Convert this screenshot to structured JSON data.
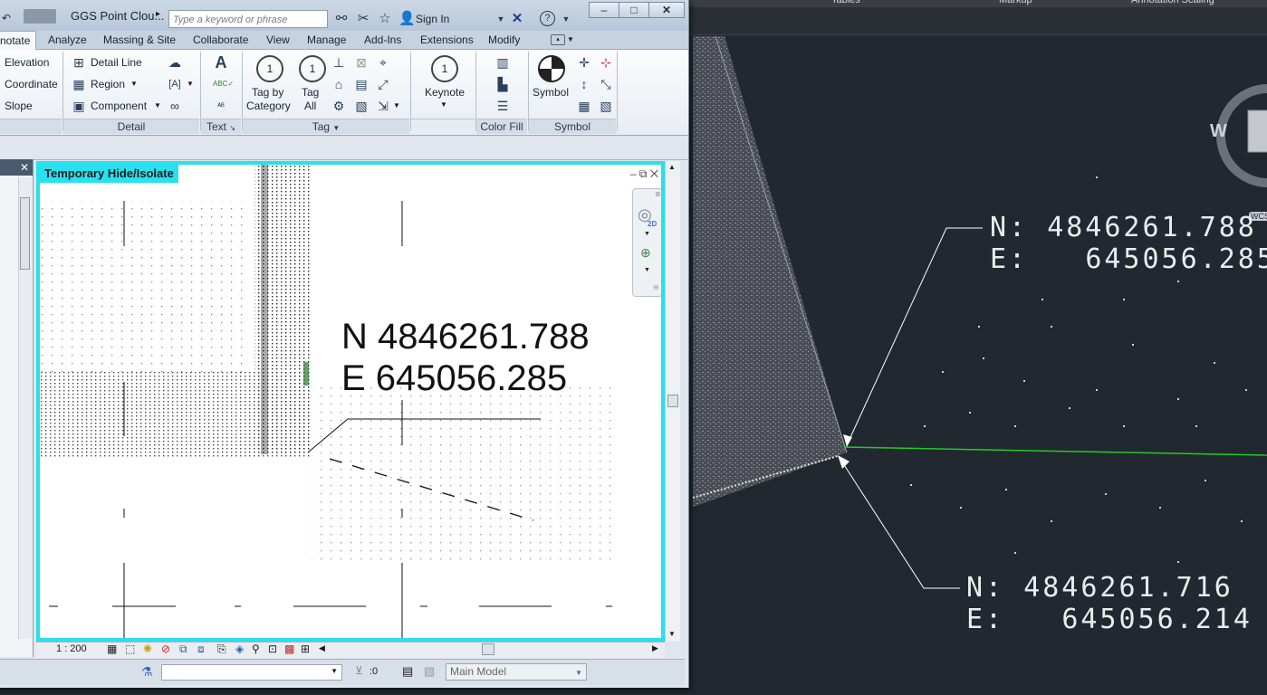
{
  "cad": {
    "tabs": [
      "Tables",
      "Markup",
      "Annotation Scaling"
    ],
    "compass": {
      "west": "W"
    },
    "wcs": "WCS",
    "upper_callout": {
      "n_label": "N:",
      "n_value": "4846261.788",
      "e_label": "E:",
      "e_value": "645056.285"
    },
    "lower_callout": {
      "n_label": "N:",
      "n_value": "4846261.716",
      "e_label": "E:",
      "e_value": "645056.214"
    },
    "colors": {
      "background": "#212830",
      "leader": "#ffffff",
      "edge_line": "#22cc22"
    }
  },
  "revit": {
    "title": "GGS Point Clou...",
    "search_placeholder": "Type a keyword or phrase",
    "sign_in": "Sign In",
    "tabs": [
      {
        "label": "notate",
        "active": true
      },
      {
        "label": "Analyze"
      },
      {
        "label": "Massing & Site"
      },
      {
        "label": "Collaborate"
      },
      {
        "label": "View"
      },
      {
        "label": "Manage"
      },
      {
        "label": "Add-Ins"
      },
      {
        "label": "Extensions"
      },
      {
        "label": "Modify"
      }
    ],
    "ribbon": {
      "spot_items": [
        "Elevation",
        "Coordinate",
        "Slope"
      ],
      "detail_items": [
        "Detail Line",
        "Region",
        "Component"
      ],
      "tag_by_category": [
        "Tag by",
        "Category"
      ],
      "tag_all": [
        "Tag",
        "All"
      ],
      "keynote": "Keynote",
      "symbol": "Symbol",
      "panels": {
        "detail": "Detail",
        "text": "Text",
        "tag": "Tag",
        "color_fill": "Color Fill",
        "symbol": "Symbol"
      }
    },
    "view": {
      "banner": "Temporary Hide/Isolate",
      "callout_n": "N 4846261.788",
      "callout_e": "E 645056.285",
      "scale": "1 : 200",
      "accent": "#28e0ee",
      "nav_2d": "2D"
    },
    "status": {
      "zero_value": ":0",
      "model": "Main Model"
    }
  }
}
